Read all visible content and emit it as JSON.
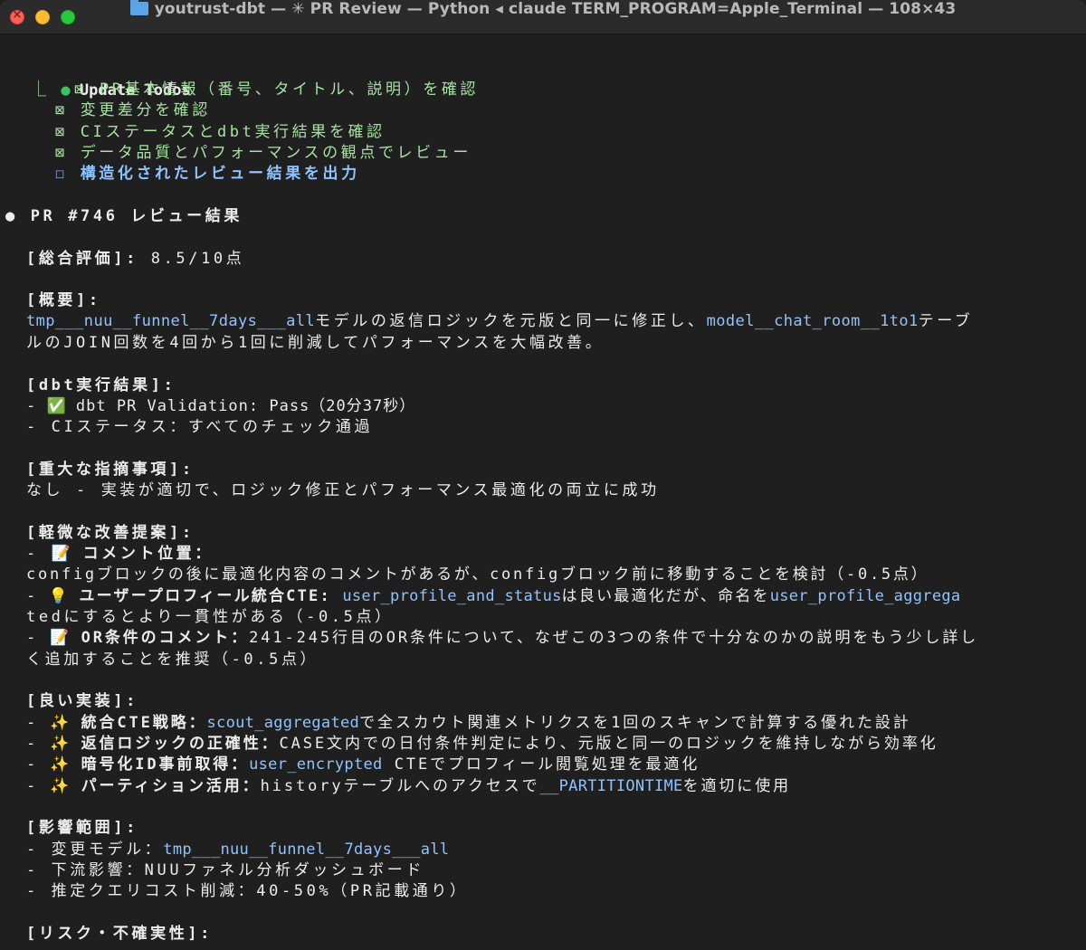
{
  "window": {
    "title": "youtrust-dbt — ✳ PR Review — Python ◂ claude TERM_PROGRAM=Apple_Terminal — 108×43"
  },
  "todos": {
    "header": "Update Todos",
    "items": [
      {
        "marker": "⊠",
        "label": "PR基本情報（番号、タイトル、説明）を確認"
      },
      {
        "marker": "⊠",
        "label": "変更差分を確認"
      },
      {
        "marker": "⊠",
        "label": "CIステータスとdbt実行結果を確認"
      },
      {
        "marker": "⊠",
        "label": "データ品質とパフォーマンスの観点でレビュー"
      },
      {
        "marker": "☐",
        "label": "構造化されたレビュー結果を出力"
      }
    ]
  },
  "review": {
    "title": "PR #746 レビュー結果",
    "overall_label": "[総合評価]:",
    "overall_value": " 8.5/10点",
    "summary_label": "[概要]:",
    "summary": {
      "code1": "tmp___nuu__funnel__7days___all",
      "text1": "モデルの返信ロジックを元版と同一に修正し、",
      "code2": "model__chat_room__1to1",
      "text2": "テーブ",
      "text3": "ルのJOIN回数を4回から1回に削減してパフォーマンスを大幅改善。"
    },
    "dbt_label": "[dbt実行結果]:",
    "dbt_items": [
      {
        "prefix": "- ",
        "emoji": "✅",
        "text": " dbt PR Validation: Pass（20分37秒）"
      },
      {
        "prefix": "- ",
        "text": "CIステータス：すべてのチェック通過"
      }
    ],
    "critical_label": "[重大な指摘事項]:",
    "critical_text": "なし - 実装が適切で、ロジック修正とパフォーマンス最適化の両立に成功",
    "minor_label": "[軽微な改善提案]:",
    "minor": {
      "item1_prefix": "- ",
      "item1_emoji": "📝",
      "item1_title": " コメント位置：",
      "item1_text": "configブロックの後に最適化内容のコメントがあるが、configブロック前に移動することを検討（-0.5点）",
      "item2_prefix": "- ",
      "item2_emoji": "💡",
      "item2_title": " ユーザープロフィール統合CTE: ",
      "item2_code1": "user_profile_and_status",
      "item2_text1": "は良い最適化だが、命名を",
      "item2_code2": "user_profile_aggrega",
      "item2_text2": "tedにするとより一貫性がある（-0.5点）",
      "item3_prefix": "- ",
      "item3_emoji": "📝",
      "item3_title": " OR条件のコメント：",
      "item3_text1": "241-245行目のOR条件について、なぜこの3つの条件で十分なのかの説明をもう少し詳し",
      "item3_text2": "く追加することを推奨（-0.5点）"
    },
    "good_label": "[良い実装]:",
    "good": {
      "i1_prefix": "- ",
      "i1_emoji": "✨",
      "i1_title": " 統合CTE戦略：",
      "i1_code": "scout_aggregated",
      "i1_text": "で全スカウト関連メトリクスを1回のスキャンで計算する優れた設計",
      "i2_prefix": "- ",
      "i2_emoji": "✨",
      "i2_title": " 返信ロジックの正確性：",
      "i2_text": "CASE文内での日付条件判定により、元版と同一のロジックを維持しながら効率化",
      "i3_prefix": "- ",
      "i3_emoji": "✨",
      "i3_title": " 暗号化ID事前取得：",
      "i3_code": "user_encrypted",
      "i3_text": " CTEでプロフィール閲覧処理を最適化",
      "i4_prefix": "- ",
      "i4_emoji": "✨",
      "i4_title": " パーティション活用：",
      "i4_text1": "historyテーブルへのアクセスで",
      "i4_code": "__PARTITIONTIME",
      "i4_text2": "を適切に使用"
    },
    "impact_label": "[影響範囲]:",
    "impact": {
      "i1_text": "- 変更モデル：",
      "i1_code": "tmp___nuu__funnel__7days___all",
      "i2_text": "- 下流影響：NUUファネル分析ダッシュボード",
      "i3_text": "- 推定クエリコスト削減：40-50%（PR記載通り）"
    },
    "risk_label": "[リスク・不確実性]:"
  },
  "colors": {
    "background": "#1f1f1f",
    "text": "#ececec",
    "todo_done": "#a6e3a1",
    "todo_pending": "#8fc3ff",
    "code": "#8fc3ff",
    "bullet_green": "#3fc060"
  }
}
